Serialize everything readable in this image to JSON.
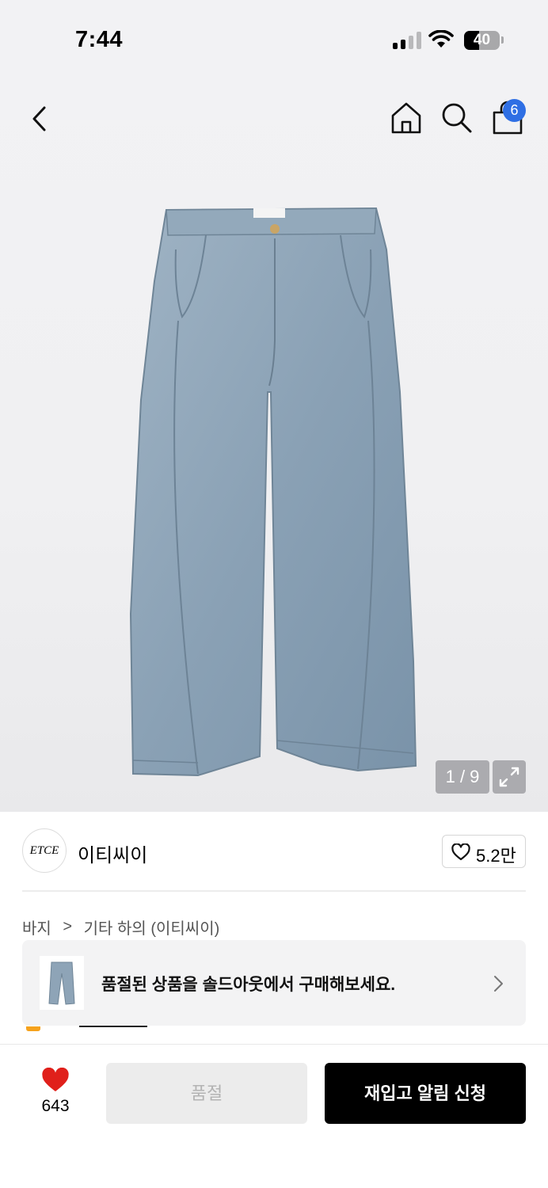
{
  "status_bar": {
    "time": "7:44",
    "battery": "40"
  },
  "header": {
    "cart_count": "6"
  },
  "gallery": {
    "counter": "1 / 9"
  },
  "brand": {
    "logo_text": "ETCE",
    "name": "이티씨이",
    "like_count": "5.2만"
  },
  "breadcrumb": {
    "category": "바지",
    "separator": ">",
    "subcategory": "기타 하의 (이티씨이)"
  },
  "soldout_banner": {
    "text": "품절된 상품을 솔드아웃에서 구매해보세요."
  },
  "bottom_bar": {
    "wish_count": "643",
    "soldout_label": "품절",
    "restock_label": "재입고 알림 신청"
  },
  "colors": {
    "accent_blue": "#2f6fe4",
    "heart_red": "#e0201b",
    "primary_button": "#000000"
  },
  "icons": [
    "back-icon",
    "home-icon",
    "search-icon",
    "shopping-bag-icon",
    "expand-icon",
    "heart-outline-icon",
    "chevron-right-icon",
    "heart-filled-icon"
  ]
}
